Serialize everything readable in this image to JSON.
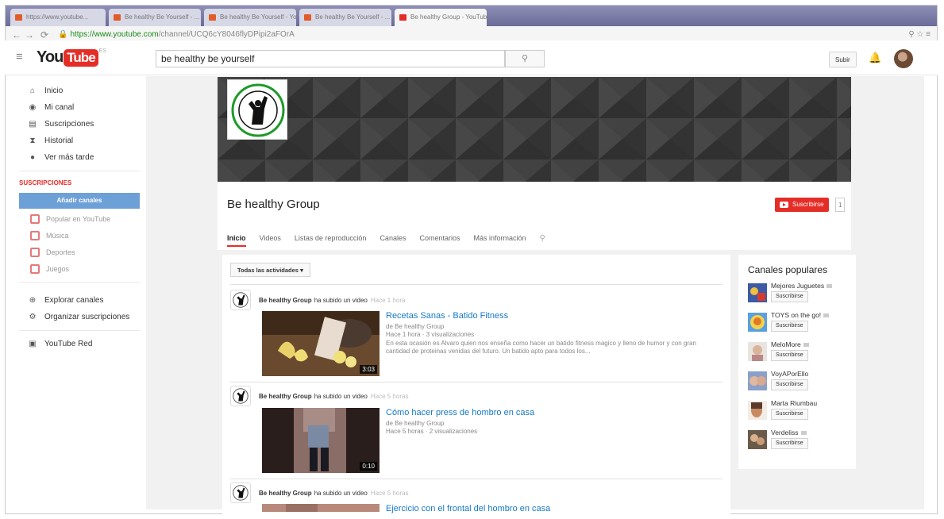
{
  "browser": {
    "tabs": [
      "https://www.youtube...",
      "Be healthy Be Yourself - ...",
      "Be healthy Be Yourself - Yo...",
      "Be healthy Be Yourself - ...",
      "Be healthy Group - YouTube"
    ],
    "url_host": "https://www.youtube.com",
    "url_path": "/channel/UCQ6cY8046flyDPipi2aFOrA"
  },
  "masthead": {
    "logo_you": "You",
    "logo_tube": "Tube",
    "logo_region": "ES",
    "search_value": "be healthy be yourself",
    "upload_label": "Subir"
  },
  "sidebar": {
    "items": [
      {
        "label": "Inicio",
        "icon": "home-icon"
      },
      {
        "label": "Mi canal",
        "icon": "person-icon"
      },
      {
        "label": "Suscripciones",
        "icon": "subscriptions-icon"
      },
      {
        "label": "Historial",
        "icon": "hourglass-icon"
      },
      {
        "label": "Ver más tarde",
        "icon": "clock-icon"
      }
    ],
    "subs_title": "SUSCRIPCIONES",
    "add_channels": "Añadir canales",
    "subs": [
      "Popular en YouTube",
      "Música",
      "Deportes",
      "Juegos"
    ],
    "explore": "Explorar canales",
    "manage": "Organizar suscripciones",
    "red": "YouTube Red"
  },
  "channel": {
    "name": "Be healthy Group",
    "subscribe_label": "Suscribirse",
    "sub_count": "1",
    "tabs": [
      "Inicio",
      "Videos",
      "Listas de reproducción",
      "Canales",
      "Comentarios",
      "Más información"
    ]
  },
  "feed": {
    "filter_label": "Todas las actividades",
    "activities": [
      {
        "owner": "Be healthy Group",
        "action": "ha subido un video",
        "time": "Hace 1 hora",
        "title": "Recetas Sanas - Batido Fitness",
        "by": "de Be healthy Group",
        "meta": "Hace 1 hora · 3 visualizaciones",
        "desc": "En esta ocasión es Alvaro quien nos enseña como hacer un batido fitness magico y lleno de humor y con gran cantidad de proteinas venidas del futuro. Un batido apto para todos los...",
        "duration": "3:03"
      },
      {
        "owner": "Be healthy Group",
        "action": "ha subido un video",
        "time": "Hace 5 horas",
        "title": "Cómo hacer press de hombro en casa",
        "by": "de Be healthy Group",
        "meta": "Hace 5 horas · 2 visualizaciones",
        "desc": "",
        "duration": "0:10"
      },
      {
        "owner": "Be healthy Group",
        "action": "ha subido un video",
        "time": "Hace 5 horas",
        "title": "Ejercicio con el frontal del hombro en casa",
        "by": "",
        "meta": "",
        "desc": "",
        "duration": ""
      }
    ]
  },
  "popular": {
    "title": "Canales populares",
    "subscribe_label": "Suscribirse",
    "channels": [
      {
        "name": "Mejores Juguetes",
        "verified": true
      },
      {
        "name": "TOYS on the go!",
        "verified": true
      },
      {
        "name": "MeloMore",
        "verified": true
      },
      {
        "name": "VoyAPorEllo",
        "verified": false
      },
      {
        "name": "Marta Riumbau",
        "verified": false
      },
      {
        "name": "Verdeliss",
        "verified": true
      }
    ]
  },
  "colors": {
    "accent": "#e52d27",
    "link": "#167ac6",
    "add_channels": "#6ea0d8"
  }
}
